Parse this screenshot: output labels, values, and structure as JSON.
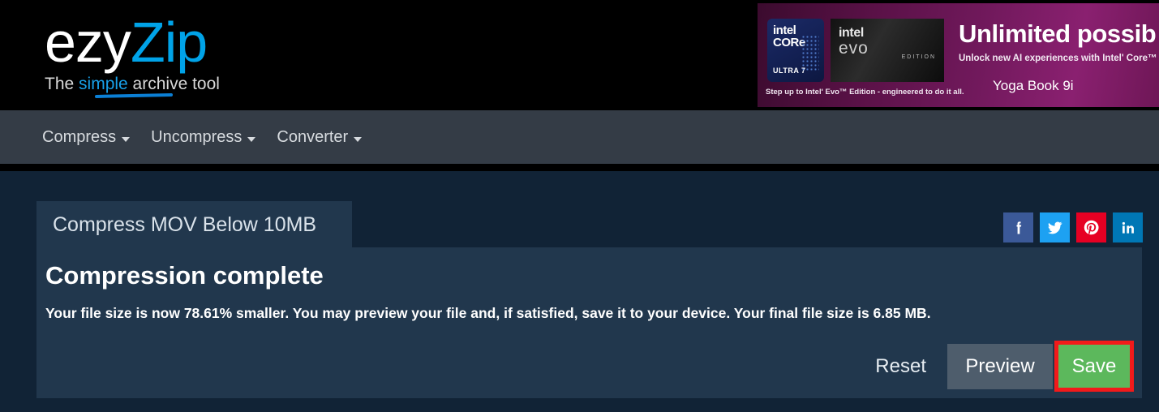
{
  "site": {
    "logo_primary": "ezy",
    "logo_secondary": "Zip",
    "tagline_prefix": "The ",
    "tagline_highlight": "simple",
    "tagline_suffix": " archive tool",
    "brand_blue": "#00a3e8"
  },
  "ad": {
    "badge_core": {
      "line1": "intel",
      "line2": "CORe",
      "line3": "ULTRA   7"
    },
    "badge_evo": {
      "line1": "intel",
      "line2": "evo",
      "edition": "EDITION"
    },
    "headline": "Unlimited possib",
    "subhead": "Unlock new AI experiences with Intelʹ Core™ Ultra",
    "product": "Yoga Book 9i",
    "footnote": "Step up to Intelʹ Evo™ Edition - engineered to do it all."
  },
  "nav": {
    "items": [
      {
        "label": "Compress",
        "has_caret": true
      },
      {
        "label": "Uncompress",
        "has_caret": true
      },
      {
        "label": "Converter",
        "has_caret": true
      }
    ]
  },
  "main": {
    "tab_label": "Compress MOV Below 10MB",
    "heading": "Compression complete",
    "body": "Your file size is now 78.61% smaller. You may preview your file and, if satisfied, save it to your device. Your final file size is 6.85 MB.",
    "stats": {
      "reduction_percent": "78.61%",
      "final_file_size": "6.85 MB"
    },
    "buttons": {
      "reset": "Reset",
      "preview": "Preview",
      "save": "Save"
    },
    "highlight_color": "#f21a1a",
    "save_color": "#5cb85c",
    "preview_color": "#4e5d6c"
  },
  "social": [
    {
      "name": "facebook",
      "color": "#3b5998"
    },
    {
      "name": "twitter",
      "color": "#1da1f2"
    },
    {
      "name": "pinterest",
      "color": "#e60023"
    },
    {
      "name": "linkedin",
      "color": "#0077b5"
    }
  ]
}
